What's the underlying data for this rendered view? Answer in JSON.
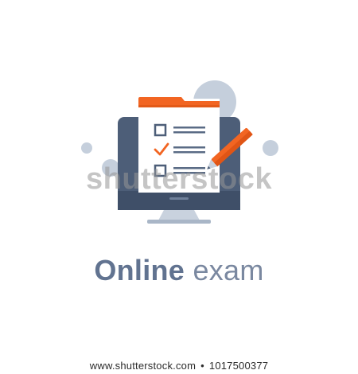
{
  "caption": {
    "bold": "Online",
    "light": "exam"
  },
  "watermark": {
    "text": "shutterstock"
  },
  "footer": {
    "url": "www.shutterstock.com",
    "separator": "•",
    "image_id": "1017500377"
  },
  "colors": {
    "monitor_frame": "#4d5e78",
    "monitor_frame_dark": "#3f4f68",
    "stand": "#c9d2de",
    "stand_base": "#a9b6c7",
    "paper": "#ffffff",
    "paper_tab": "#f26522",
    "pencil": "#f26522",
    "checkmark": "#f26522",
    "checkbox": "#4d5e78",
    "lines": "#5a6b85",
    "bubble": "#c5cfdc",
    "caption": "#617390"
  },
  "icons": [
    "monitor-icon",
    "checklist-paper-icon",
    "pencil-icon",
    "checkbox-icon",
    "checkmark-icon"
  ]
}
